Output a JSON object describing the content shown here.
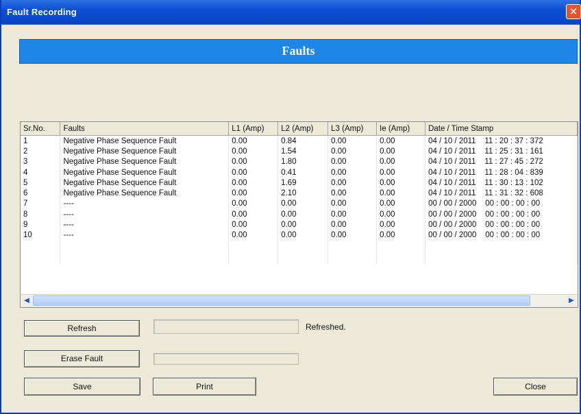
{
  "window": {
    "title": "Fault Recording"
  },
  "banner": {
    "title": "Faults"
  },
  "table": {
    "columns": [
      "Sr.No.",
      "Faults",
      "L1 (Amp)",
      "L2 (Amp)",
      "L3 (Amp)",
      "Ie (Amp)",
      "Date / Time Stamp"
    ],
    "rows": [
      [
        "1",
        "Negative Phase Sequence Fault",
        "0.00",
        "0.84",
        "0.00",
        "0.00",
        "04 / 10 / 2011    11 : 20 : 37 : 372"
      ],
      [
        "2",
        "Negative Phase Sequence Fault",
        "0.00",
        "1.54",
        "0.00",
        "0.00",
        "04 / 10 / 2011    11 : 25 : 31 : 161"
      ],
      [
        "3",
        "Negative Phase Sequence Fault",
        "0.00",
        "1.80",
        "0.00",
        "0.00",
        "04 / 10 / 2011    11 : 27 : 45 : 272"
      ],
      [
        "4",
        "Negative Phase Sequence Fault",
        "0.00",
        "0.41",
        "0.00",
        "0.00",
        "04 / 10 / 2011    11 : 28 : 04 : 839"
      ],
      [
        "5",
        "Negative Phase Sequence Fault",
        "0.00",
        "1.69",
        "0.00",
        "0.00",
        "04 / 10 / 2011    11 : 30 : 13 : 102"
      ],
      [
        "6",
        "Negative Phase Sequence Fault",
        "0.00",
        "2.10",
        "0.00",
        "0.00",
        "04 / 10 / 2011    11 : 31 : 32 : 608"
      ],
      [
        "7",
        "----",
        "0.00",
        "0.00",
        "0.00",
        "0.00",
        "00 / 00 / 2000    00 : 00 : 00 : 00"
      ],
      [
        "8",
        "----",
        "0.00",
        "0.00",
        "0.00",
        "0.00",
        "00 / 00 / 2000    00 : 00 : 00 : 00"
      ],
      [
        "9",
        "----",
        "0.00",
        "0.00",
        "0.00",
        "0.00",
        "00 / 00 / 2000    00 : 00 : 00 : 00"
      ],
      [
        "10",
        "----",
        "0.00",
        "0.00",
        "0.00",
        "0.00",
        "00 / 00 / 2000    00 : 00 : 00 : 00"
      ]
    ]
  },
  "buttons": {
    "refresh": "Refresh",
    "erase": "Erase Fault",
    "save": "Save",
    "print": "Print",
    "close": "Close"
  },
  "status": {
    "refresh_text": "Refreshed."
  },
  "icons": {
    "close": "close-icon",
    "scroll_left": "arrow-left-icon",
    "scroll_right": "arrow-right-icon"
  },
  "colors": {
    "titlebar": "#0b4fd3",
    "banner": "#1e86e6",
    "dialog_bg": "#ece9d8"
  }
}
